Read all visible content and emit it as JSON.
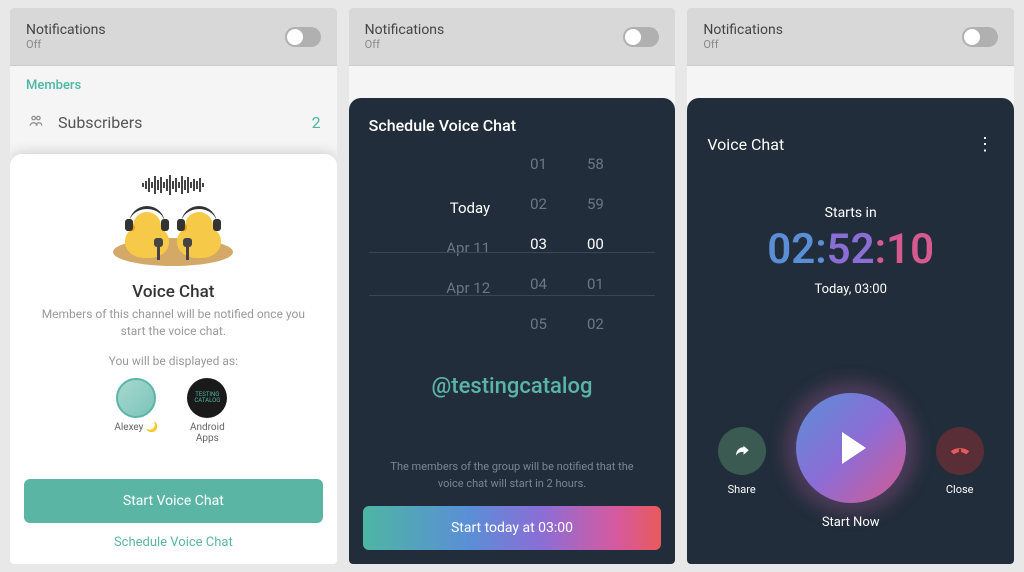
{
  "notif": {
    "title": "Notifications",
    "sub": "Off"
  },
  "screen1": {
    "members_label": "Members",
    "subs_label": "Subscribers",
    "subs_count": "2",
    "title": "Voice Chat",
    "desc": "Members of this channel will be notified once you start the voice chat.",
    "displayed_as": "You will be displayed as:",
    "avatars": [
      {
        "name": "Alexey 🌙"
      },
      {
        "name": "Android Apps"
      }
    ],
    "start_btn": "Start Voice Chat",
    "schedule_link": "Schedule Voice Chat"
  },
  "screen2": {
    "title": "Schedule Voice Chat",
    "picker": {
      "dates": [
        "",
        "",
        "Today",
        "Apr 11",
        "Apr 12"
      ],
      "hours": [
        "01",
        "02",
        "03",
        "04",
        "05"
      ],
      "mins": [
        "58",
        "59",
        "00",
        "01",
        "02"
      ]
    },
    "notice": "The members of the group will be notified that the voice chat will start in 2 hours.",
    "btn": "Start today at 03:00"
  },
  "screen3": {
    "title": "Voice Chat",
    "starts_in": "Starts in",
    "countdown": {
      "h": "02",
      "m": "52",
      "s": "10"
    },
    "when": "Today, 03:00",
    "share": "Share",
    "close": "Close",
    "start_now": "Start Now"
  },
  "watermark": "@testingcatalog"
}
